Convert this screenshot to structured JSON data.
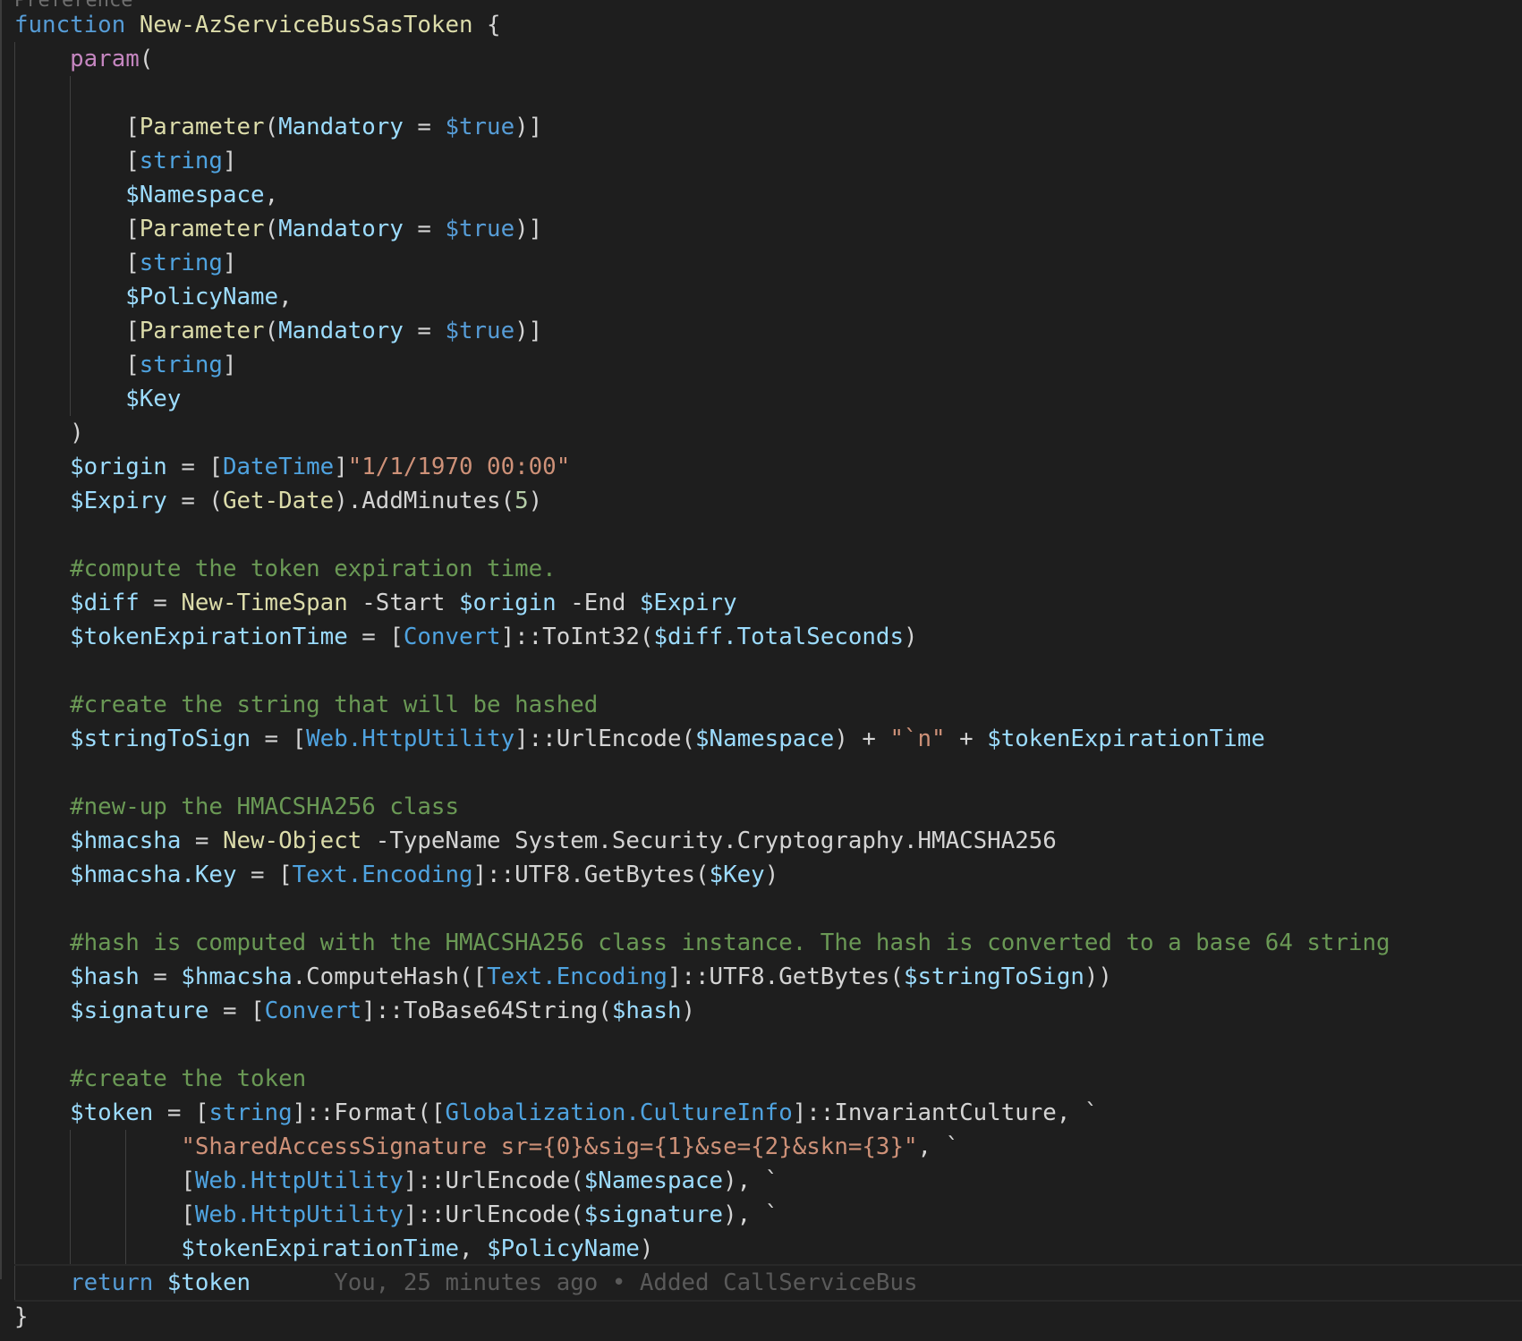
{
  "editor": {
    "partial_top_text": "Preference",
    "blame": "You, 25 minutes ago • Added CallServiceBus",
    "lines": [
      [
        [
          "kw",
          "function "
        ],
        [
          "fn",
          "New-AzServiceBusSasToken"
        ],
        [
          "op",
          " {"
        ]
      ],
      [
        [
          "op",
          "    "
        ],
        [
          "pm",
          "param"
        ],
        [
          "op",
          "("
        ]
      ],
      [],
      [
        [
          "op",
          "        ["
        ],
        [
          "fn",
          "Parameter"
        ],
        [
          "op",
          "("
        ],
        [
          "var",
          "Mandatory"
        ],
        [
          "op",
          " = "
        ],
        [
          "kw",
          "$true"
        ],
        [
          "op",
          ")]"
        ]
      ],
      [
        [
          "op",
          "        ["
        ],
        [
          "typ",
          "string"
        ],
        [
          "op",
          "]"
        ]
      ],
      [
        [
          "op",
          "        "
        ],
        [
          "var",
          "$Namespace"
        ],
        [
          "op",
          ","
        ]
      ],
      [
        [
          "op",
          "        ["
        ],
        [
          "fn",
          "Parameter"
        ],
        [
          "op",
          "("
        ],
        [
          "var",
          "Mandatory"
        ],
        [
          "op",
          " = "
        ],
        [
          "kw",
          "$true"
        ],
        [
          "op",
          ")]"
        ]
      ],
      [
        [
          "op",
          "        ["
        ],
        [
          "typ",
          "string"
        ],
        [
          "op",
          "]"
        ]
      ],
      [
        [
          "op",
          "        "
        ],
        [
          "var",
          "$PolicyName"
        ],
        [
          "op",
          ","
        ]
      ],
      [
        [
          "op",
          "        ["
        ],
        [
          "fn",
          "Parameter"
        ],
        [
          "op",
          "("
        ],
        [
          "var",
          "Mandatory"
        ],
        [
          "op",
          " = "
        ],
        [
          "kw",
          "$true"
        ],
        [
          "op",
          ")]"
        ]
      ],
      [
        [
          "op",
          "        ["
        ],
        [
          "typ",
          "string"
        ],
        [
          "op",
          "]"
        ]
      ],
      [
        [
          "op",
          "        "
        ],
        [
          "var",
          "$Key"
        ]
      ],
      [
        [
          "op",
          "    )"
        ]
      ],
      [
        [
          "op",
          "    "
        ],
        [
          "var",
          "$origin"
        ],
        [
          "op",
          " = ["
        ],
        [
          "typ",
          "DateTime"
        ],
        [
          "op",
          "]"
        ],
        [
          "str",
          "\"1/1/1970 00:00\""
        ]
      ],
      [
        [
          "op",
          "    "
        ],
        [
          "var",
          "$Expiry"
        ],
        [
          "op",
          " = ("
        ],
        [
          "fn",
          "Get-Date"
        ],
        [
          "op",
          ").AddMinutes("
        ],
        [
          "num",
          "5"
        ],
        [
          "op",
          ")"
        ]
      ],
      [],
      [
        [
          "op",
          "    "
        ],
        [
          "cmt",
          "#compute the token expiration time."
        ]
      ],
      [
        [
          "op",
          "    "
        ],
        [
          "var",
          "$diff"
        ],
        [
          "op",
          " = "
        ],
        [
          "fn",
          "New-TimeSpan"
        ],
        [
          "op",
          " -Start "
        ],
        [
          "var",
          "$origin"
        ],
        [
          "op",
          " -End "
        ],
        [
          "var",
          "$Expiry"
        ]
      ],
      [
        [
          "op",
          "    "
        ],
        [
          "var",
          "$tokenExpirationTime"
        ],
        [
          "op",
          " = ["
        ],
        [
          "typ",
          "Convert"
        ],
        [
          "op",
          "]::ToInt32("
        ],
        [
          "var",
          "$diff.TotalSeconds"
        ],
        [
          "op",
          ")"
        ]
      ],
      [],
      [
        [
          "op",
          "    "
        ],
        [
          "cmt",
          "#create the string that will be hashed"
        ]
      ],
      [
        [
          "op",
          "    "
        ],
        [
          "var",
          "$stringToSign"
        ],
        [
          "op",
          " = ["
        ],
        [
          "typ",
          "Web.HttpUtility"
        ],
        [
          "op",
          "]::UrlEncode("
        ],
        [
          "var",
          "$Namespace"
        ],
        [
          "op",
          ") + "
        ],
        [
          "str",
          "\"`n\""
        ],
        [
          "op",
          " + "
        ],
        [
          "var",
          "$tokenExpirationTime"
        ]
      ],
      [],
      [
        [
          "op",
          "    "
        ],
        [
          "cmt",
          "#new-up the HMACSHA256 class"
        ]
      ],
      [
        [
          "op",
          "    "
        ],
        [
          "var",
          "$hmacsha"
        ],
        [
          "op",
          " = "
        ],
        [
          "fn",
          "New-Object"
        ],
        [
          "op",
          " -TypeName System.Security.Cryptography.HMACSHA256"
        ]
      ],
      [
        [
          "op",
          "    "
        ],
        [
          "var",
          "$hmacsha.Key"
        ],
        [
          "op",
          " = ["
        ],
        [
          "typ",
          "Text.Encoding"
        ],
        [
          "op",
          "]::UTF8.GetBytes("
        ],
        [
          "var",
          "$Key"
        ],
        [
          "op",
          ")"
        ]
      ],
      [],
      [
        [
          "op",
          "    "
        ],
        [
          "cmt",
          "#hash is computed with the HMACSHA256 class instance. The hash is converted to a base 64 string"
        ]
      ],
      [
        [
          "op",
          "    "
        ],
        [
          "var",
          "$hash"
        ],
        [
          "op",
          " = "
        ],
        [
          "var",
          "$hmacsha"
        ],
        [
          "op",
          ".ComputeHash(["
        ],
        [
          "typ",
          "Text.Encoding"
        ],
        [
          "op",
          "]::UTF8.GetBytes("
        ],
        [
          "var",
          "$stringToSign"
        ],
        [
          "op",
          "))"
        ]
      ],
      [
        [
          "op",
          "    "
        ],
        [
          "var",
          "$signature"
        ],
        [
          "op",
          " = ["
        ],
        [
          "typ",
          "Convert"
        ],
        [
          "op",
          "]::ToBase64String("
        ],
        [
          "var",
          "$hash"
        ],
        [
          "op",
          ")"
        ]
      ],
      [],
      [
        [
          "op",
          "    "
        ],
        [
          "cmt",
          "#create the token"
        ]
      ],
      [
        [
          "op",
          "    "
        ],
        [
          "var",
          "$token"
        ],
        [
          "op",
          " = ["
        ],
        [
          "typ",
          "string"
        ],
        [
          "op",
          "]::Format(["
        ],
        [
          "typ",
          "Globalization.CultureInfo"
        ],
        [
          "op",
          "]::InvariantCulture, `"
        ]
      ],
      [
        [
          "op",
          "            "
        ],
        [
          "str",
          "\"SharedAccessSignature sr={0}&sig={1}&se={2}&skn={3}\""
        ],
        [
          "op",
          ", `"
        ]
      ],
      [
        [
          "op",
          "            ["
        ],
        [
          "typ",
          "Web.HttpUtility"
        ],
        [
          "op",
          "]::UrlEncode("
        ],
        [
          "var",
          "$Namespace"
        ],
        [
          "op",
          "), `"
        ]
      ],
      [
        [
          "op",
          "            ["
        ],
        [
          "typ",
          "Web.HttpUtility"
        ],
        [
          "op",
          "]::UrlEncode("
        ],
        [
          "var",
          "$signature"
        ],
        [
          "op",
          "), `"
        ]
      ],
      [
        [
          "op",
          "            "
        ],
        [
          "var",
          "$tokenExpirationTime"
        ],
        [
          "op",
          ", "
        ],
        [
          "var",
          "$PolicyName"
        ],
        [
          "op",
          ")"
        ]
      ],
      [
        [
          "op",
          "    "
        ],
        [
          "kw",
          "return "
        ],
        [
          "var",
          "$token"
        ]
      ],
      [
        [
          "op",
          "}"
        ]
      ]
    ]
  }
}
